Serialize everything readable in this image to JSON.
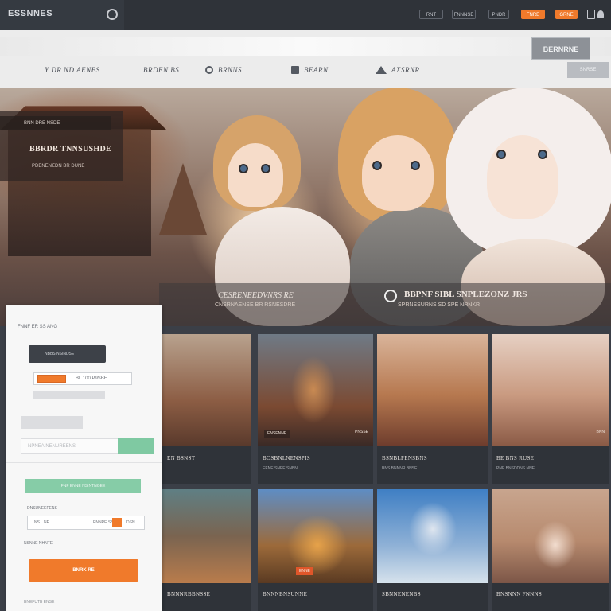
{
  "topbar": {
    "logo": "ESSNNES",
    "buttons": [
      {
        "label": "RNT",
        "style": "outline"
      },
      {
        "label": "FNNNSE",
        "style": "outline"
      },
      {
        "label": "PNDR",
        "style": "outline"
      },
      {
        "label": "FNRE",
        "style": "orange"
      },
      {
        "label": "GRNE",
        "style": "orange"
      }
    ]
  },
  "subbar": {
    "nav": [
      {
        "label": "Y DR ND AENES",
        "icon": "none"
      },
      {
        "label": "BRDEN BS",
        "icon": "none"
      },
      {
        "label": "BRNNS",
        "icon": "circle"
      },
      {
        "label": "BEARN",
        "icon": "box"
      },
      {
        "label": "AXSRNR",
        "icon": "triangle"
      }
    ],
    "search_button": "BERNRNE",
    "secondary_button": "SNRSE"
  },
  "hero": {
    "card_badge": "BNN  DRE  NSDE",
    "card_title": "BBRDR  TNNSUSHDE",
    "card_sub": "PDENENEDN BR  DUNE",
    "caption_1": "CESRENEEDVNRS RE",
    "caption_1_sub": "CNSRNAENSE BR RSNESDRE",
    "caption_2": "BBPNF  SIBL SNPLEZONZ JRS",
    "caption_2_sub": "SPRNSSURNS  SD SPE NRNKR"
  },
  "panel": {
    "title": "FNNF ER  SS ANG",
    "dark_button": "NBBS NSINDSE",
    "range_label": "BL  100  P9SBE",
    "input_placeholder": "NPNEAINENUREENS",
    "green_bar": "FNF ENNE NS  NTNGEE",
    "qty_label": "DNSUNEEFENS",
    "qty_left": "NS",
    "qty_value": "NE",
    "qty_mid": "ENNRE  SNE",
    "qty_right": "DSN",
    "note": "NSNNE NHNTE",
    "cta": "BNRK  RE",
    "footer": "BNEFUTB  ENSE"
  },
  "grid": {
    "cards": [
      {
        "name": "EN BSNST",
        "meta": "",
        "label": "",
        "label_r": ""
      },
      {
        "name": "BOSBNLNENSPIS",
        "meta": "EENE  SNEE  SNBN",
        "label": "ENSENNE",
        "label_r": "PNSSE"
      },
      {
        "name": "BSNBLPENSBNS",
        "meta": "BNS  BNNNR  BNSE",
        "label": "",
        "label_r": ""
      },
      {
        "name": "BE  BNS  RUSE",
        "meta": "PNE  BNSDDNS  NNE",
        "label": "",
        "label_r": "BNN"
      },
      {
        "name": "BNNNRBBNSSE",
        "meta": "",
        "label": "",
        "label_r": ""
      },
      {
        "name": "BNNNBNSUNNE",
        "meta": "",
        "label": "ENNE",
        "label_r": ""
      },
      {
        "name": "SBNNENENBS",
        "meta": "",
        "label": "",
        "label_r": ""
      },
      {
        "name": "BNSNNN FNNNS",
        "meta": "",
        "label": "",
        "label_r": ""
      }
    ]
  },
  "colors": {
    "accent_orange": "#f07a2b",
    "accent_green": "#86cca7",
    "dark_bg": "#2f3339"
  }
}
